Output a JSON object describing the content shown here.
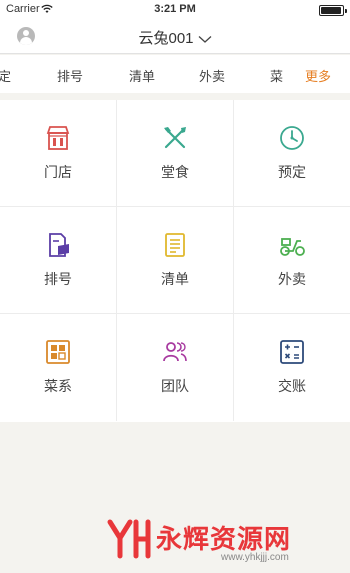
{
  "status_bar": {
    "carrier": "Carrier",
    "time": "3:21 PM",
    "battery_level": 0.95
  },
  "nav": {
    "title": "云兔001"
  },
  "tabs": [
    {
      "label": "定"
    },
    {
      "label": "排号"
    },
    {
      "label": "清单"
    },
    {
      "label": "外卖"
    },
    {
      "label": "菜"
    },
    {
      "label": "更多"
    }
  ],
  "grid": [
    {
      "label": "门店",
      "icon": "store-icon",
      "color": "#d9534f"
    },
    {
      "label": "堂食",
      "icon": "fork-knife-icon",
      "color": "#3aa88f"
    },
    {
      "label": "预定",
      "icon": "clock-icon",
      "color": "#3aa88f"
    },
    {
      "label": "排号",
      "icon": "queue-ticket-icon",
      "color": "#5b3ea6"
    },
    {
      "label": "清单",
      "icon": "list-icon",
      "color": "#e0b82d"
    },
    {
      "label": "外卖",
      "icon": "scooter-icon",
      "color": "#4caf50"
    },
    {
      "label": "菜系",
      "icon": "menu-grid-icon",
      "color": "#d9892b"
    },
    {
      "label": "团队",
      "icon": "team-icon",
      "color": "#a83aa0"
    },
    {
      "label": "交账",
      "icon": "calculator-icon",
      "color": "#2d4a7a"
    }
  ],
  "watermark": {
    "text": "永辉资源网",
    "url": "www.yhkjjj.com"
  }
}
